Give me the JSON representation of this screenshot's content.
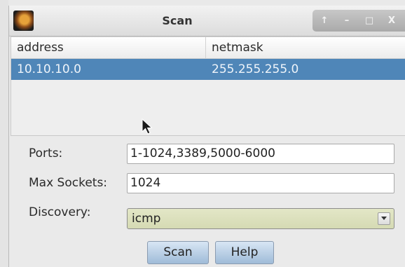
{
  "window": {
    "title": "Scan",
    "controls": [
      "↑",
      "–",
      "□",
      "X"
    ]
  },
  "table": {
    "columns": [
      "address",
      "netmask"
    ],
    "rows": [
      {
        "address": "10.10.10.0",
        "netmask": "255.255.255.0",
        "selected": true
      }
    ]
  },
  "form": {
    "ports_label": "Ports:",
    "ports_value": "1-1024,3389,5000-6000",
    "max_sockets_label": "Max Sockets:",
    "max_sockets_value": "1024",
    "discovery_label": "Discovery:",
    "discovery_value": "icmp"
  },
  "buttons": {
    "scan": "Scan",
    "help": "Help"
  },
  "colors": {
    "selection": "#4f86b8",
    "discovery_bg": "#dde1bd",
    "button_bg": "#b8cee5"
  }
}
